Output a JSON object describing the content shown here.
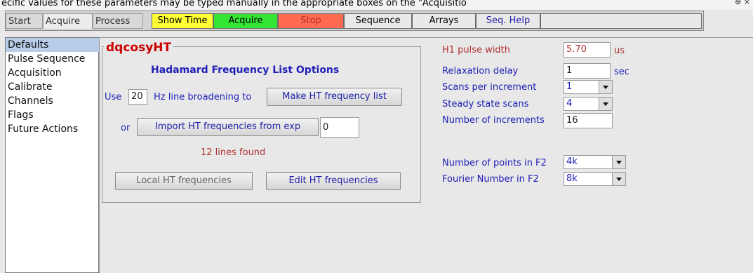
{
  "top_banner": "ecific values for these parameters may be typed manually in the appropriate boxes on the \"Acquisitio",
  "tabs": [
    "Start",
    "Acquire",
    "Process"
  ],
  "toolbar": {
    "show_time": "Show Time",
    "acquire": "Acquire",
    "stop": "Stop",
    "sequence": "Sequence",
    "arrays": "Arrays",
    "seq_help": "Seq. Help"
  },
  "sidebar": {
    "items": [
      "Defaults",
      "Pulse Sequence",
      "Acquisition",
      "Calibrate",
      "Channels",
      "Flags",
      "Future Actions"
    ],
    "selected": "Defaults"
  },
  "panel": {
    "title": "dqcosyHT",
    "heading": "Hadamard Frequency List Options",
    "use_label": "Use",
    "broadening_value": "20",
    "broadening_label": "Hz line broadening to",
    "make_button": "Make HT frequency list",
    "or_label": "or",
    "import_button": "Import HT frequencies from exp",
    "import_value": "0",
    "lines_found": "12 lines found",
    "local_button": "Local HT frequencies",
    "edit_button": "Edit HT frequencies"
  },
  "params": {
    "h1_pw_label": "H1 pulse width",
    "h1_pw_value": "5.70",
    "h1_pw_unit": "us",
    "relax_label": "Relaxation delay",
    "relax_value": "1",
    "relax_unit": "sec",
    "scans_label": "Scans per increment",
    "scans_value": "1",
    "ss_label": "Steady state scans",
    "ss_value": "4",
    "incr_label": "Number of increments",
    "incr_value": "16",
    "np_label": "Number of points in F2",
    "np_value": "4k",
    "fn_label": "Fourier Number in F2",
    "fn_value": "8k"
  }
}
